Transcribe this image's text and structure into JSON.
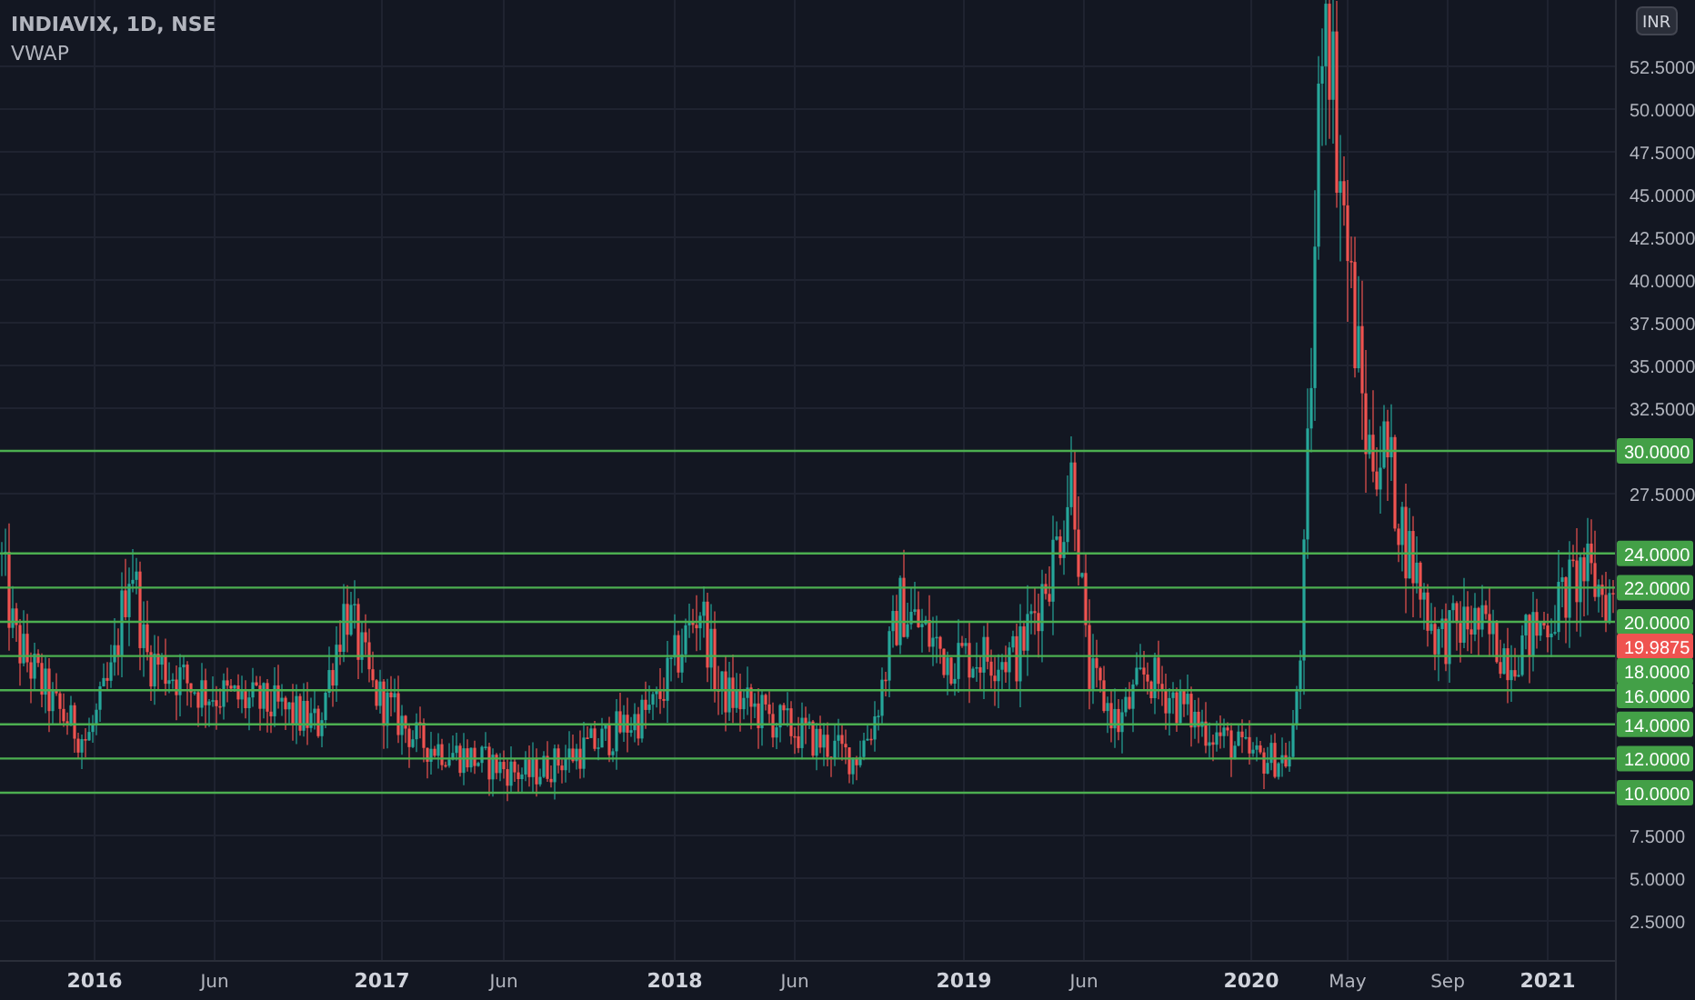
{
  "legend": {
    "symbol": "INDIAVIX, 1D, NSE",
    "indicator": "VWAP"
  },
  "currency": "INR",
  "y_axis": {
    "ticks": [
      "52.5000",
      "50.0000",
      "47.5000",
      "45.0000",
      "42.5000",
      "40.0000",
      "37.5000",
      "35.0000",
      "32.5000",
      "27.5000",
      "7.5000",
      "5.0000",
      "2.5000"
    ]
  },
  "levels": [
    "30.0000",
    "24.0000",
    "22.0000",
    "20.0000",
    "18.0000",
    "16.0000",
    "14.0000",
    "12.0000",
    "10.0000"
  ],
  "last_price": "19.9875",
  "x_axis": {
    "labels": [
      {
        "label": "2016",
        "kind": "year"
      },
      {
        "label": "Jun",
        "kind": "month"
      },
      {
        "label": "2017",
        "kind": "year"
      },
      {
        "label": "Jun",
        "kind": "month"
      },
      {
        "label": "2018",
        "kind": "year"
      },
      {
        "label": "Jun",
        "kind": "month"
      },
      {
        "label": "2019",
        "kind": "year"
      },
      {
        "label": "Jun",
        "kind": "month"
      },
      {
        "label": "2020",
        "kind": "year"
      },
      {
        "label": "May",
        "kind": "month"
      },
      {
        "label": "Sep",
        "kind": "month"
      },
      {
        "label": "2021",
        "kind": "year"
      }
    ]
  }
}
